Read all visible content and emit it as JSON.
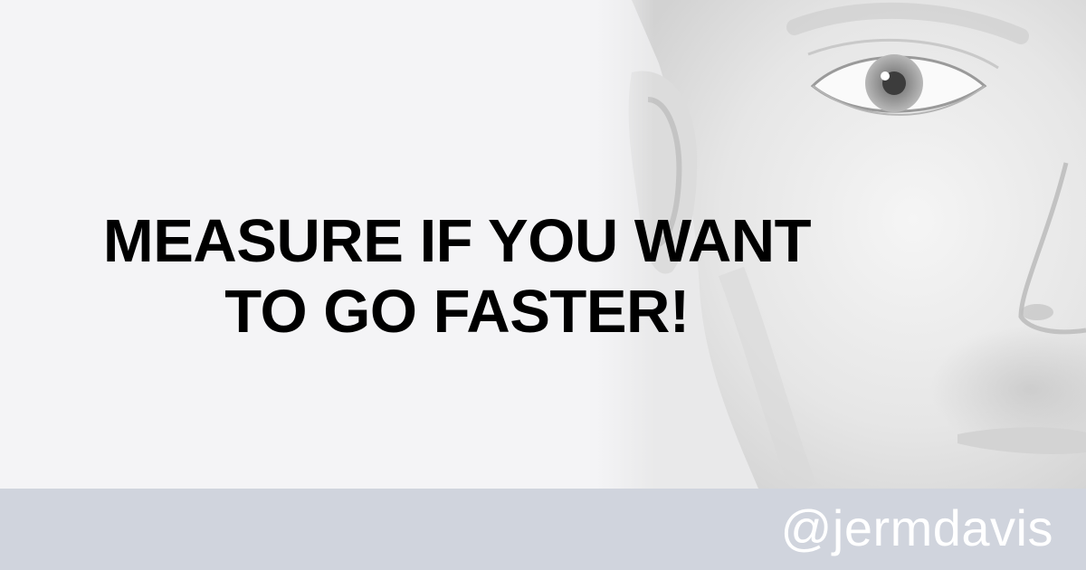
{
  "headline": {
    "line1": "MEASURE IF YOU WANT",
    "line2": "TO GO FASTER!"
  },
  "footer": {
    "handle": "@jermdavis"
  },
  "photo": {
    "subject": "face-closeup-icon"
  },
  "colors": {
    "background": "#f4f4f6",
    "footer_bar": "#d0d4dd",
    "headline_text": "#000000",
    "handle_text": "#ffffff"
  }
}
